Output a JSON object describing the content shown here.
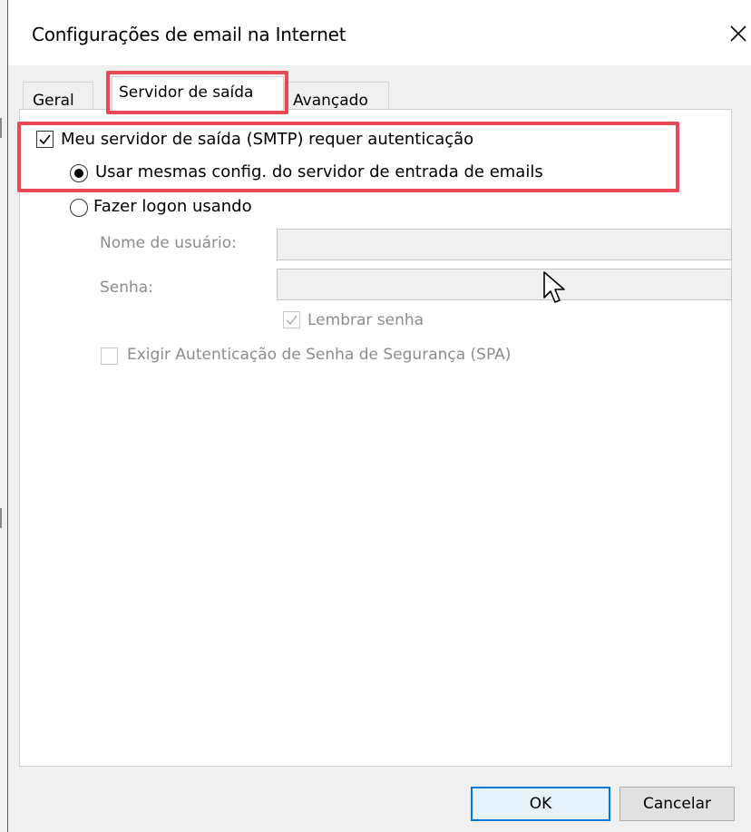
{
  "window": {
    "title": "Configurações de email na Internet"
  },
  "tabs": [
    {
      "label": "Geral"
    },
    {
      "label": "Servidor de saída",
      "selected": true
    },
    {
      "label": "Avançado"
    }
  ],
  "options": {
    "smtp_auth_label": "Meu servidor de saída (SMTP) requer autenticação",
    "smtp_auth_checked": true,
    "same_settings_label": "Usar mesmas config. do servidor de entrada de emails",
    "logon_using_label": "Fazer logon usando",
    "selected_radio": "same_settings"
  },
  "logon": {
    "username_label": "Nome de usuário:",
    "username_value": "",
    "password_label": "Senha:",
    "password_value": "",
    "remember_label": "Lembrar senha",
    "remember_checked": true,
    "spa_label": "Exigir Autenticação de Senha de Segurança (SPA)",
    "spa_checked": false
  },
  "buttons": {
    "ok": "OK",
    "cancel": "Cancelar"
  },
  "colors": {
    "highlight": "#e84a55",
    "accent": "#0078d7"
  },
  "icons": {
    "close": "close-icon",
    "cursor": "mouse-pointer-icon"
  }
}
